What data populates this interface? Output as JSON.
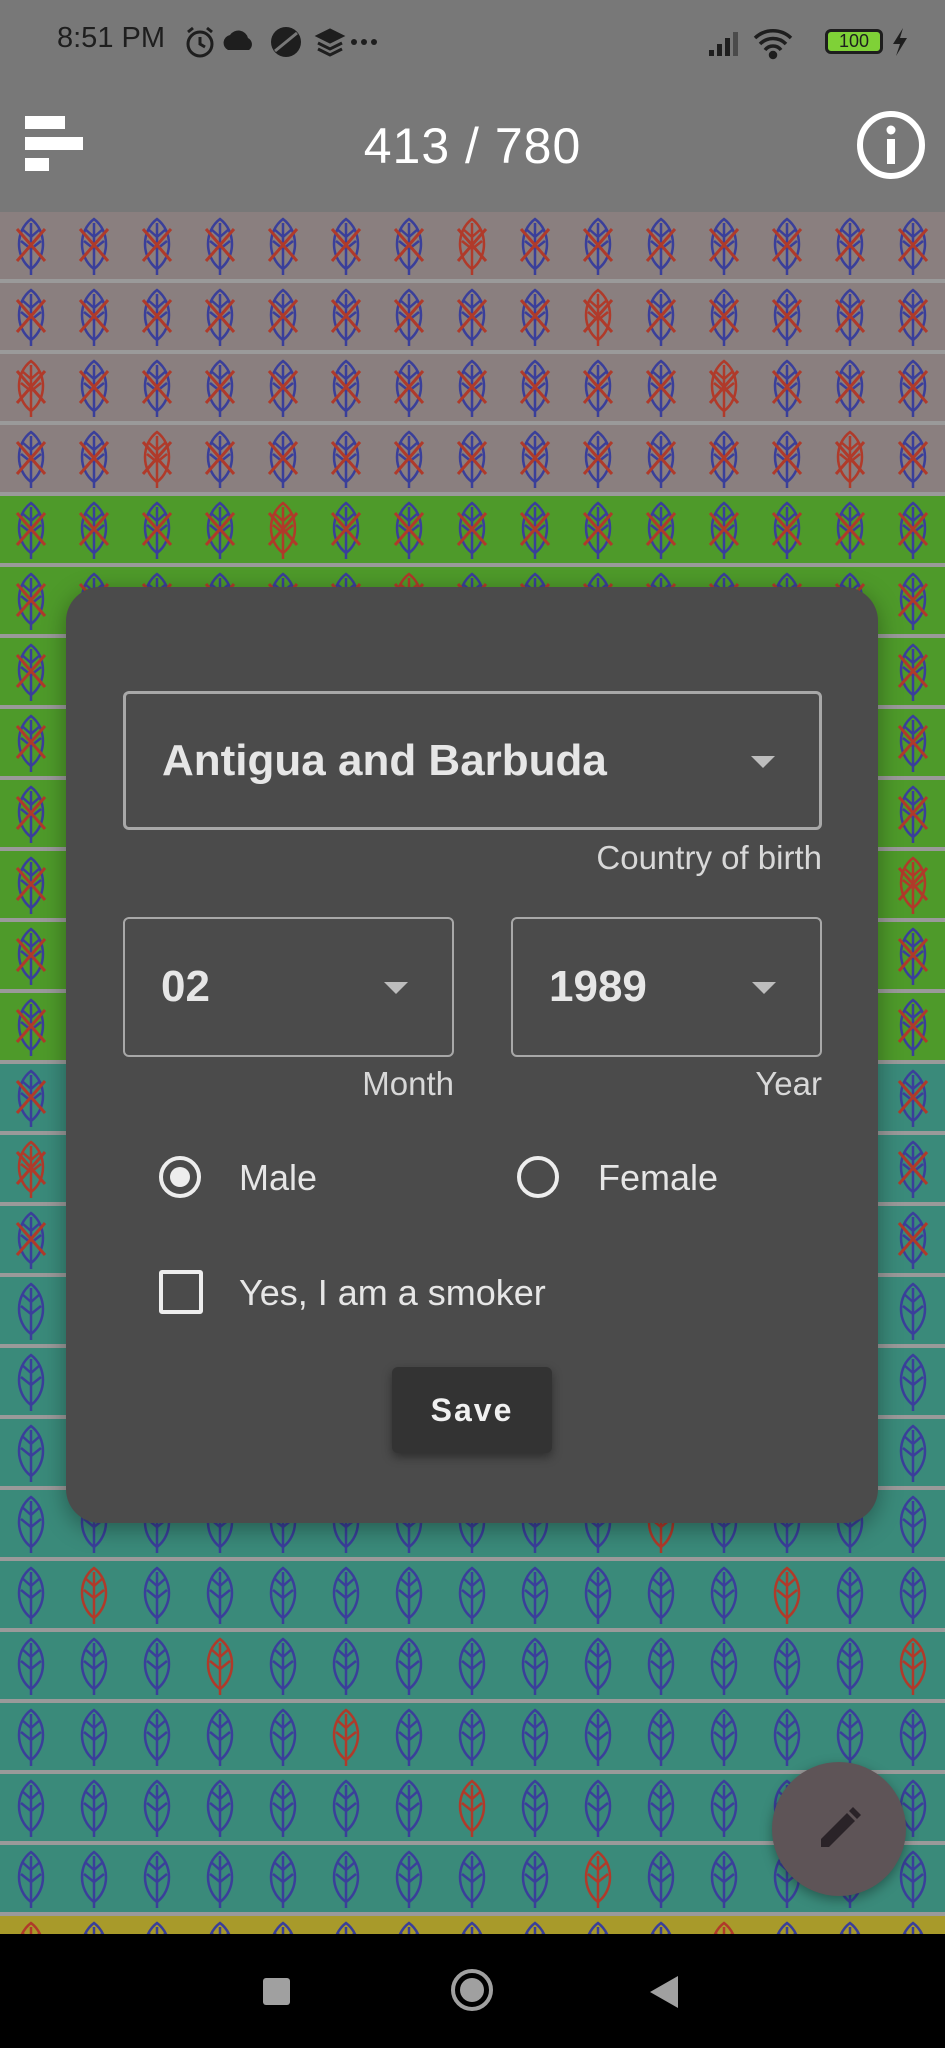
{
  "status_bar": {
    "time": "8:51 PM",
    "left_icons": [
      "alarm-icon",
      "cloud-icon",
      "no-entry-icon",
      "layers-icon",
      "more-dots-icon"
    ],
    "right_icons": [
      "signal-icon",
      "wifi-icon",
      "battery-icon",
      "charging-icon"
    ],
    "battery_level": "100"
  },
  "app_bar": {
    "title": "413 / 780",
    "menu_icon": "sort-menu-icon",
    "info_icon": "info-icon"
  },
  "colors": {
    "row_background_gray": "#8a7f7f",
    "row_background_green": "#4e9a2a",
    "row_background_teal": "#3a8a7a",
    "row_background_yellow": "#a89a2a",
    "leaf_blue": "#3a3f9a",
    "leaf_red": "#b03a2a",
    "dialog_background": "#4b4b4b"
  },
  "dialog": {
    "country": {
      "value": "Antigua and Barbuda",
      "helper": "Country of birth"
    },
    "month": {
      "value": "02",
      "helper": "Month"
    },
    "year": {
      "value": "1989",
      "helper": "Year"
    },
    "gender": {
      "options": [
        "Male",
        "Female"
      ],
      "selected": "Male"
    },
    "smoker": {
      "label": "Yes, I am a smoker",
      "checked": false
    },
    "save_label": "Save"
  },
  "fab": {
    "icon": "pencil-icon"
  },
  "nav_bar": {
    "icons": [
      "recent-apps-icon",
      "home-icon",
      "back-icon"
    ]
  }
}
